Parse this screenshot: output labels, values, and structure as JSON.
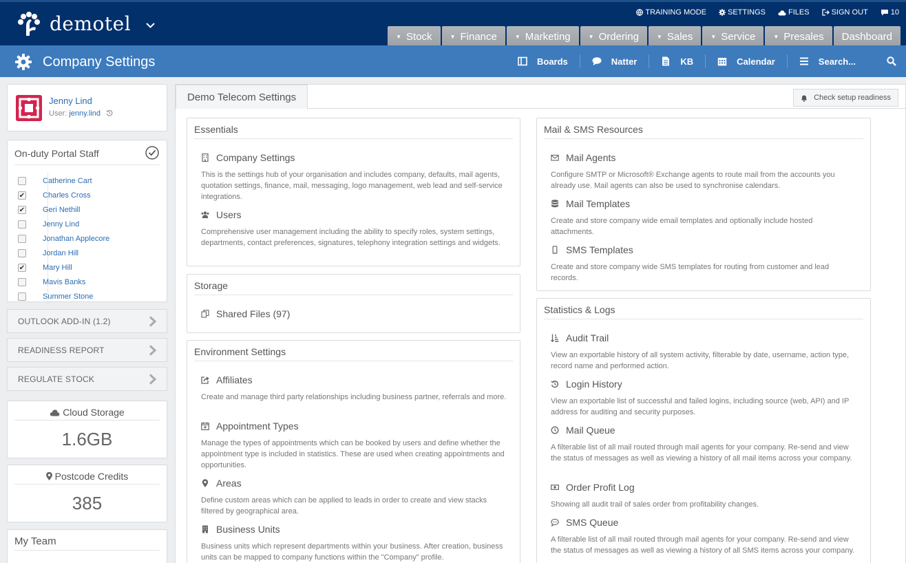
{
  "brand": {
    "name": "demotel"
  },
  "utility": [
    {
      "label": "TRAINING MODE",
      "icon": "globe-icon"
    },
    {
      "label": "SETTINGS",
      "icon": "gear-icon"
    },
    {
      "label": "FILES",
      "icon": "cloud-icon"
    },
    {
      "label": "SIGN OUT",
      "icon": "sign-out-icon"
    },
    {
      "label": "10",
      "icon": "chat-icon"
    }
  ],
  "mainnav": [
    {
      "label": "Stock"
    },
    {
      "label": "Finance"
    },
    {
      "label": "Marketing"
    },
    {
      "label": "Ordering"
    },
    {
      "label": "Sales"
    },
    {
      "label": "Service"
    },
    {
      "label": "Presales"
    },
    {
      "label": "Dashboard"
    }
  ],
  "page": {
    "title": "Company Settings"
  },
  "subnav": [
    {
      "label": "Boards",
      "icon": "boards-icon"
    },
    {
      "label": "Natter",
      "icon": "speech-bubble-icon"
    },
    {
      "label": "KB",
      "icon": "document-icon"
    },
    {
      "label": "Calendar",
      "icon": "calendar-icon"
    },
    {
      "label": "Search...",
      "icon": "menu-icon"
    }
  ],
  "user": {
    "name": "Jenny Lind",
    "login_prefix": "User: ",
    "login": "jenny.lind"
  },
  "staff": {
    "title": "On-duty Portal Staff",
    "members": [
      {
        "name": "Catherine Cart",
        "checked": false
      },
      {
        "name": "Charles Cross",
        "checked": true
      },
      {
        "name": "Geri Nethill",
        "checked": true
      },
      {
        "name": "Jenny Lind",
        "checked": false
      },
      {
        "name": "Jonathan Applecore",
        "checked": false
      },
      {
        "name": "Jordan Hill",
        "checked": false
      },
      {
        "name": "Mary Hill",
        "checked": true
      },
      {
        "name": "Mavis Banks",
        "checked": false
      },
      {
        "name": "Summer Stone",
        "checked": false
      }
    ]
  },
  "collapsers": [
    {
      "label": "OUTLOOK ADD-IN (1.2)"
    },
    {
      "label": "READINESS REPORT"
    },
    {
      "label": "REGULATE STOCK"
    }
  ],
  "cloud_storage": {
    "title": "Cloud Storage",
    "value": "1.6GB"
  },
  "postcode_credits": {
    "title": "Postcode Credits",
    "value": "385"
  },
  "team": {
    "title": "My Team"
  },
  "main": {
    "tab": "Demo Telecom Settings",
    "readiness_button": "Check setup readiness"
  },
  "panels": {
    "essentials": {
      "title": "Essentials",
      "items": [
        {
          "title": "Company Settings",
          "icon": "building-icon",
          "desc": "This is the settings hub of your organisation and includes company, defaults, mail agents, quotation settings, finance, mail, messaging, logo management, web lead and self-service integrations."
        },
        {
          "title": "Users",
          "icon": "users-icon",
          "desc": "Comprehensive user management including the ability to specify roles, system settings, departments, contact preferences, signatures, telephony integration settings and widgets."
        }
      ]
    },
    "storage": {
      "title": "Storage",
      "items": [
        {
          "title": "Shared Files (97)",
          "icon": "files-icon"
        }
      ]
    },
    "environment": {
      "title": "Environment Settings",
      "items": [
        {
          "title": "Affiliates",
          "icon": "share-icon",
          "desc": "Create and manage third party relationships including business partner, referrals and more."
        },
        {
          "title": "Appointment Types",
          "icon": "calendar-plus-icon",
          "desc": "Manage the types of appointments which can be booked by users and define whether the appointment type is included in statistics. These are used when creating appointments and opportunities."
        },
        {
          "title": "Areas",
          "icon": "map-marker-icon",
          "desc": "Define custom areas which can be applied to leads in order to create and view stacks filtered by geographical area."
        },
        {
          "title": "Business Units",
          "icon": "building-icon",
          "desc": "Business units which represent departments within your business. After creation, business units can be mapped to company functions within the \"Company\" profile."
        }
      ]
    },
    "mail": {
      "title": "Mail & SMS Resources",
      "items": [
        {
          "title": "Mail Agents",
          "icon": "envelope-icon",
          "desc": "Configure SMTP or Microsoft® Exchange agents to route mail from the accounts you already use. Mail agents can also be used to synchronise calendars."
        },
        {
          "title": "Mail Templates",
          "icon": "database-icon",
          "desc": "Create and store company wide email templates and optionally include hosted attachments."
        },
        {
          "title": "SMS Templates",
          "icon": "mobile-icon",
          "desc": "Create and store company wide SMS templates for routing from customer and lead records."
        }
      ]
    },
    "stats": {
      "title": "Statistics & Logs",
      "items": [
        {
          "title": "Audit Trail",
          "icon": "sort-icon",
          "desc": "View an exportable history of all system activity, filterable by date, username, action type, record name and performed action."
        },
        {
          "title": "Login History",
          "icon": "history-icon",
          "desc": "View an exportable list of successful and failed logins, including source (web, API) and IP address for auditing and security purposes."
        },
        {
          "title": "Mail Queue",
          "icon": "clock-icon",
          "desc": "A filterable list of all mail routed through mail agents for your company. Re-send and view the status of messages as well as viewing a history of all mail items across your company."
        },
        {
          "title": "Order Profit Log",
          "icon": "money-icon",
          "desc": "Showing all audit trail of sales order from profitability changes."
        },
        {
          "title": "SMS Queue",
          "icon": "comment-icon",
          "desc": "A filterable list of all mail routed through mail agents for your company. Re-send and view the status of messages as well as viewing a history of all SMS items across your company."
        }
      ]
    }
  },
  "colors": {
    "topbar": "#02306b",
    "subbar": "#3d7bbd",
    "link": "#2a6db3",
    "avatar": "#d2254f"
  }
}
